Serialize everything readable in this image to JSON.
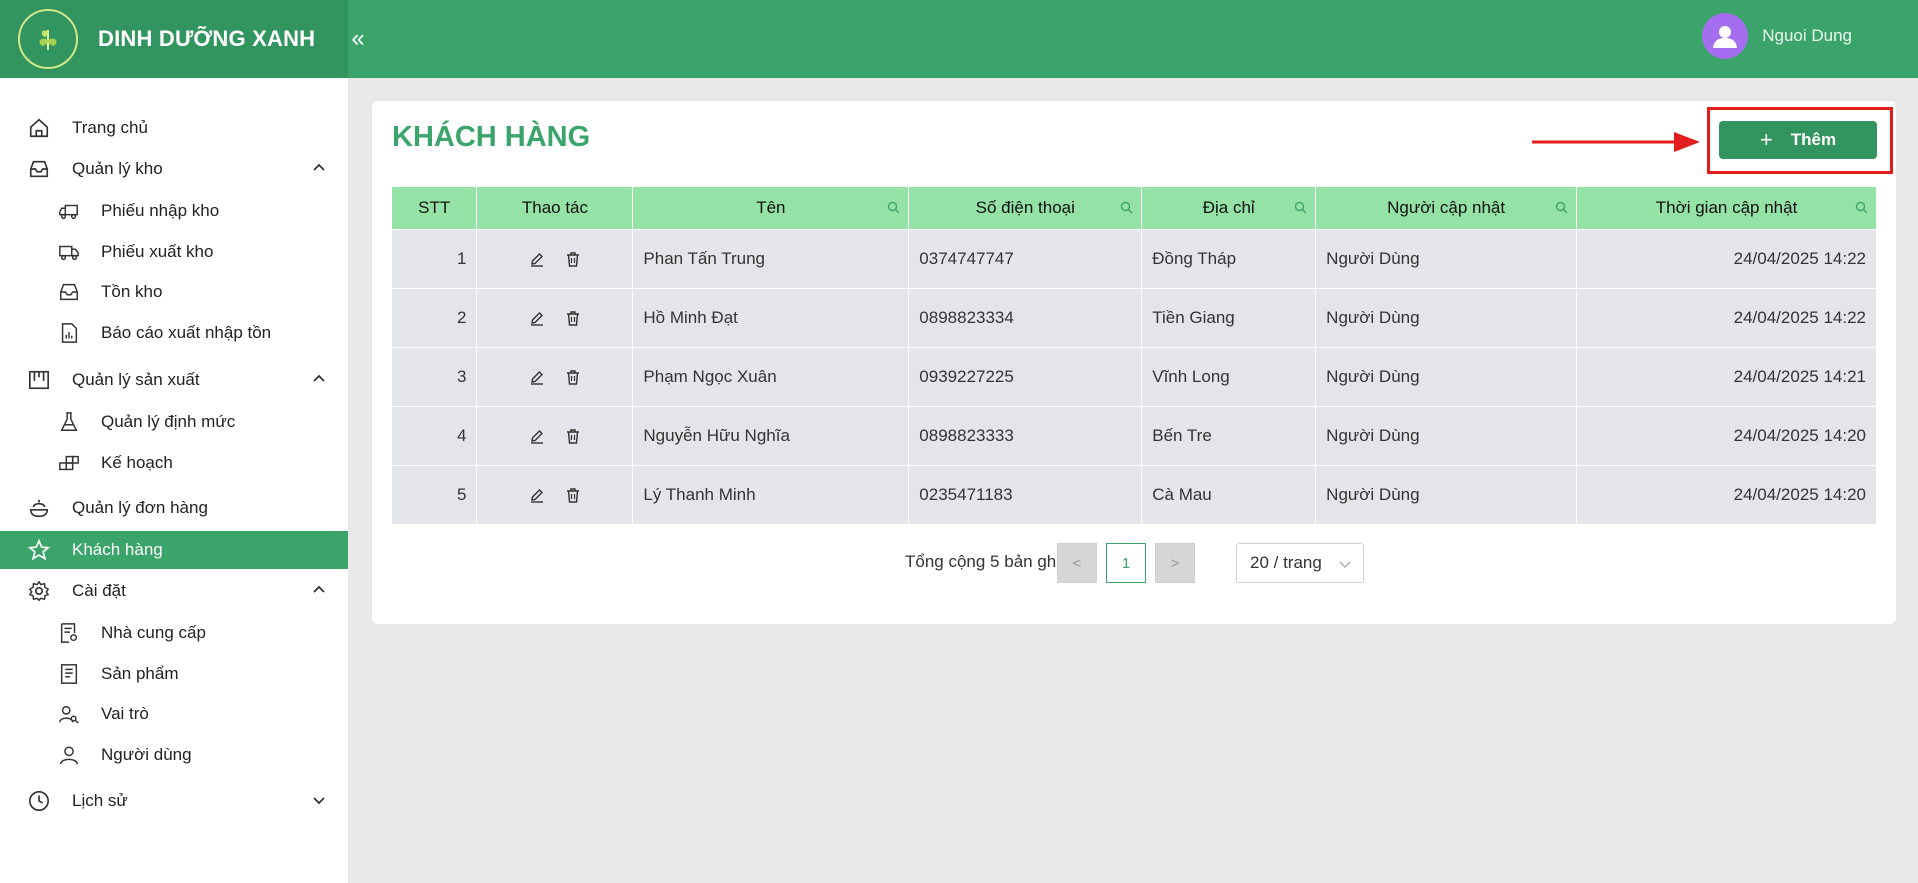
{
  "app": {
    "brand": "DINH DƯỠNG XANH",
    "collapse_icon": "«",
    "user_name": "Nguoi Dung"
  },
  "sidebar": {
    "items": [
      {
        "label": "Trang chủ",
        "icon": "home-icon"
      },
      {
        "label": "Quản lý kho",
        "icon": "inbox-icon"
      },
      {
        "label": "Phiếu nhập kho",
        "icon": "truck-in-icon"
      },
      {
        "label": "Phiếu xuất kho",
        "icon": "truck-out-icon"
      },
      {
        "label": "Tồn kho",
        "icon": "inbox-icon"
      },
      {
        "label": "Báo cáo xuất nhập tồn",
        "icon": "report-icon"
      },
      {
        "label": "Quản lý sản xuất",
        "icon": "factory-icon"
      },
      {
        "label": "Quản lý định mức",
        "icon": "flask-icon"
      },
      {
        "label": "Kế hoạch",
        "icon": "blocks-icon"
      },
      {
        "label": "Quản lý đơn hàng",
        "icon": "dish-icon"
      },
      {
        "label": "Khách hàng",
        "icon": "star-icon"
      },
      {
        "label": "Cài đặt",
        "icon": "gear-icon"
      },
      {
        "label": "Nhà cung cấp",
        "icon": "supplier-icon"
      },
      {
        "label": "Sản phẩm",
        "icon": "product-icon"
      },
      {
        "label": "Vai trò",
        "icon": "users-icon"
      },
      {
        "label": "Người dùng",
        "icon": "user-icon"
      },
      {
        "label": "Lịch sử",
        "icon": "clock-icon"
      }
    ]
  },
  "page": {
    "title": "KHÁCH HÀNG",
    "add_button": "Thêm",
    "add_icon": "+"
  },
  "table": {
    "headers": [
      "STT",
      "Thao tác",
      "Tên",
      "Số điện thoại",
      "Địa chỉ",
      "Người cập nhật",
      "Thời gian cập nhật"
    ],
    "rows": [
      {
        "stt": "1",
        "name": "Phan Tấn Trung",
        "phone": "0374747747",
        "address": "Đồng Tháp",
        "updater": "Người Dùng",
        "time": "24/04/2025 14:22"
      },
      {
        "stt": "2",
        "name": "Hồ Minh Đạt",
        "phone": "0898823334",
        "address": "Tiền Giang",
        "updater": "Người Dùng",
        "time": "24/04/2025 14:22"
      },
      {
        "stt": "3",
        "name": "Phạm Ngọc Xuân",
        "phone": "0939227225",
        "address": "Vĩnh Long",
        "updater": "Người Dùng",
        "time": "24/04/2025 14:21"
      },
      {
        "stt": "4",
        "name": "Nguyễn Hữu Nghĩa",
        "phone": "0898823333",
        "address": "Bến Tre",
        "updater": "Người Dùng",
        "time": "24/04/2025 14:20"
      },
      {
        "stt": "5",
        "name": "Lý Thanh Minh",
        "phone": "0235471183",
        "address": "Cà Mau",
        "updater": "Người Dùng",
        "time": "24/04/2025 14:20"
      }
    ]
  },
  "pagination": {
    "total_text": "Tổng cộng 5 bản ghi",
    "prev": "<",
    "current_page": "1",
    "next": ">",
    "page_size": "20 / trang"
  },
  "colors": {
    "primary": "#3aa46a",
    "header_row": "#94e2a5",
    "highlight": "#e11d1d"
  }
}
